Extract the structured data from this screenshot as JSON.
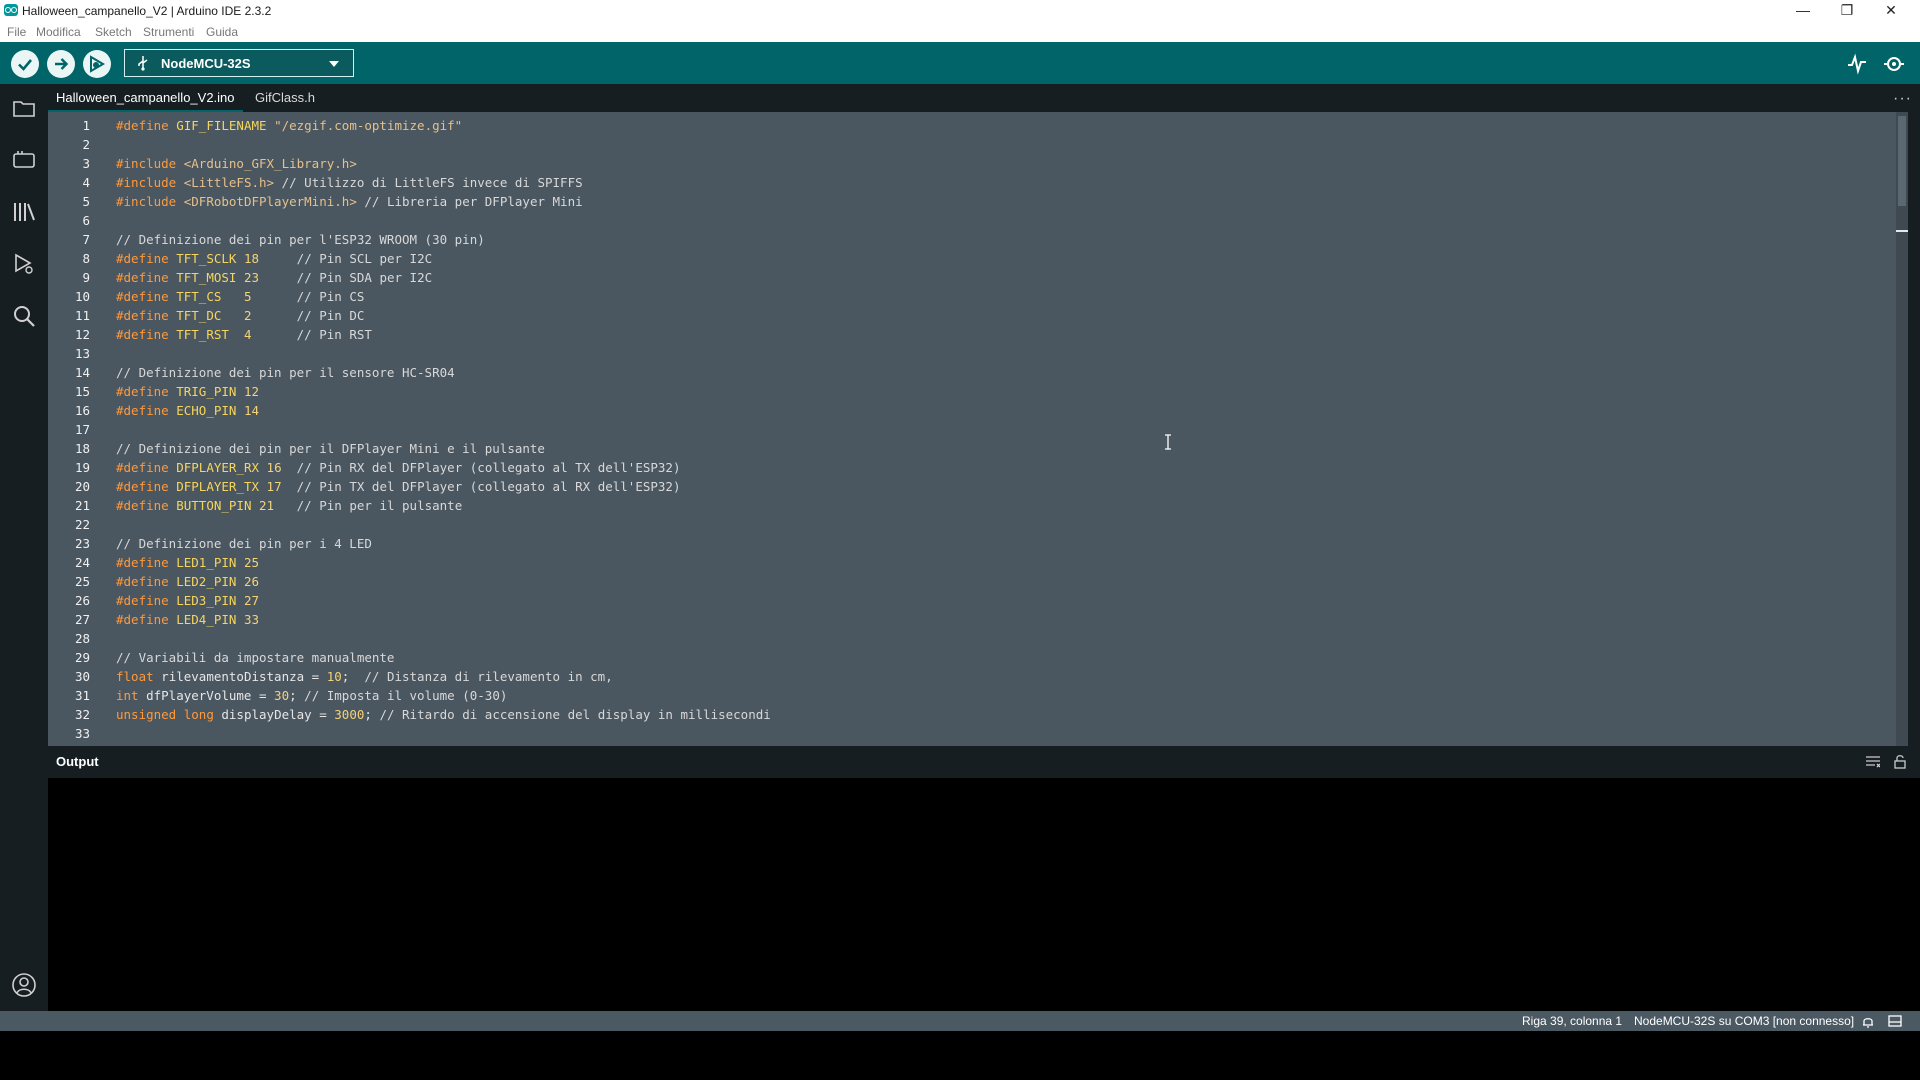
{
  "window": {
    "title": "Halloween_campanello_V2 | Arduino IDE 2.3.2",
    "controls": [
      "minimize-icon",
      "restore-icon",
      "close-icon"
    ]
  },
  "menu": [
    "File",
    "Modifica",
    "Sketch",
    "Strumenti",
    "Guida"
  ],
  "toolbar": {
    "buttons": [
      "verify-icon",
      "upload-icon",
      "debug-icon"
    ],
    "board": "NodeMCU-32S",
    "right_icons": [
      "serial-plotter-icon",
      "serial-monitor-icon"
    ]
  },
  "sidebar": [
    "sketchbook-folder-icon",
    "boards-manager-icon",
    "library-manager-icon",
    "debug-run-icon",
    "search-icon",
    "account-icon"
  ],
  "tabs": [
    "Halloween_campanello_V2.ino",
    "GifClass.h"
  ],
  "code": [
    "#define GIF_FILENAME \"/ezgif.com-optimize.gif\"",
    "",
    "#include <Arduino_GFX_Library.h>",
    "#include <LittleFS.h> // Utilizzo di LittleFS invece di SPIFFS",
    "#include <DFRobotDFPlayerMini.h> // Libreria per DFPlayer Mini",
    "",
    "// Definizione dei pin per l'ESP32 WROOM (30 pin)",
    "#define TFT_SCLK 18     // Pin SCL per I2C",
    "#define TFT_MOSI 23     // Pin SDA per I2C",
    "#define TFT_CS   5      // Pin CS",
    "#define TFT_DC   2      // Pin DC",
    "#define TFT_RST  4      // Pin RST",
    "",
    "// Definizione dei pin per il sensore HC-SR04",
    "#define TRIG_PIN 12",
    "#define ECHO_PIN 14",
    "",
    "// Definizione dei pin per il DFPlayer Mini e il pulsante",
    "#define DFPLAYER_RX 16  // Pin RX del DFPlayer (collegato al TX dell'ESP32)",
    "#define DFPLAYER_TX 17  // Pin TX del DFPlayer (collegato al RX dell'ESP32)",
    "#define BUTTON_PIN 21   // Pin per il pulsante",
    "",
    "// Definizione dei pin per i 4 LED",
    "#define LED1_PIN 25",
    "#define LED2_PIN 26",
    "#define LED3_PIN 27",
    "#define LED4_PIN 33",
    "",
    "// Variabili da impostare manualmente",
    "float rilevamentoDistanza = 10;  // Distanza di rilevamento in cm,",
    "int dfPlayerVolume = 30; // Imposta il volume (0-30)",
    "unsigned long displayDelay = 3000; // Ritardo di accensione del display in millisecondi",
    ""
  ],
  "output": {
    "title": "Output",
    "icons": [
      "clear-output-icon",
      "lock-scroll-icon"
    ]
  },
  "status": {
    "position": "Riga 39, colonna 1",
    "board_port": "NodeMCU-32S su COM3 [non connesso]",
    "icons": [
      "notifications-icon",
      "toggle-output-icon"
    ]
  },
  "colors": {
    "toolbar": "#006468",
    "editor_bg": "#4a5660",
    "sidebar_bg": "#171e21",
    "output_bg": "#000000",
    "status_bg": "#4b5962",
    "keyword": "#ff9a3c",
    "macro": "#f6d55c"
  }
}
